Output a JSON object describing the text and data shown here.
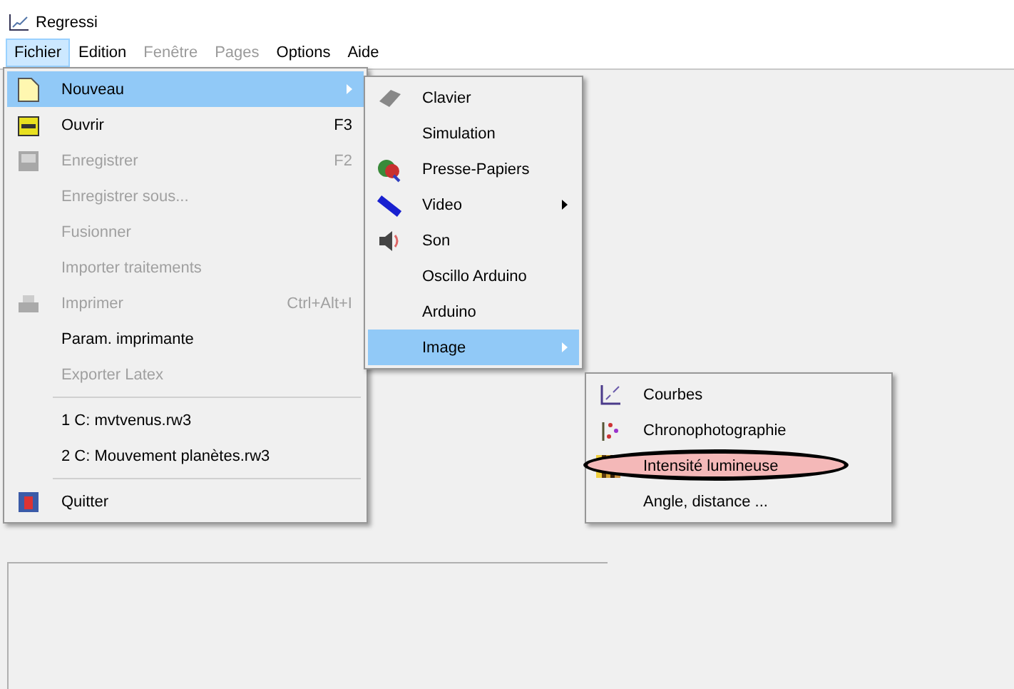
{
  "window": {
    "title": "Regressi"
  },
  "menu_bar": [
    {
      "label": "Fichier",
      "selected": true,
      "disabled": false
    },
    {
      "label": "Edition",
      "selected": false,
      "disabled": false
    },
    {
      "label": "Fenêtre",
      "selected": false,
      "disabled": true
    },
    {
      "label": "Pages",
      "selected": false,
      "disabled": true
    },
    {
      "label": "Options",
      "selected": false,
      "disabled": false
    },
    {
      "label": "Aide",
      "selected": false,
      "disabled": false
    }
  ],
  "file_menu": [
    {
      "kind": "item",
      "label": "Nouveau",
      "selected": true,
      "disabled": false,
      "submenu": true
    },
    {
      "kind": "item",
      "label": "Ouvrir",
      "shortcut": "F3",
      "selected": false,
      "disabled": false,
      "submenu": false
    },
    {
      "kind": "item",
      "label": "Enregistrer",
      "shortcut": "F2",
      "selected": false,
      "disabled": true,
      "submenu": false
    },
    {
      "kind": "item",
      "label": "Enregistrer sous...",
      "selected": false,
      "disabled": true,
      "submenu": false
    },
    {
      "kind": "item",
      "label": "Fusionner",
      "selected": false,
      "disabled": true,
      "submenu": false
    },
    {
      "kind": "item",
      "label": "Importer traitements",
      "selected": false,
      "disabled": true,
      "submenu": false
    },
    {
      "kind": "item",
      "label": "Imprimer",
      "shortcut": "Ctrl+Alt+I",
      "selected": false,
      "disabled": true,
      "submenu": false
    },
    {
      "kind": "item",
      "label": "Param. imprimante",
      "selected": false,
      "disabled": false,
      "submenu": false
    },
    {
      "kind": "item",
      "label": "Exporter Latex",
      "selected": false,
      "disabled": true,
      "submenu": false
    },
    {
      "kind": "separator"
    },
    {
      "kind": "item",
      "label": "1 C: mvtvenus.rw3",
      "selected": false,
      "disabled": false,
      "submenu": false
    },
    {
      "kind": "item",
      "label": "2 C: Mouvement planètes.rw3",
      "selected": false,
      "disabled": false,
      "submenu": false
    },
    {
      "kind": "separator"
    },
    {
      "kind": "item",
      "label": "Quitter",
      "selected": false,
      "disabled": false,
      "submenu": false
    }
  ],
  "new_submenu": [
    {
      "kind": "item",
      "label": "Clavier",
      "selected": false,
      "disabled": false,
      "submenu": false
    },
    {
      "kind": "item",
      "label": "Simulation",
      "selected": false,
      "disabled": false,
      "submenu": false
    },
    {
      "kind": "item",
      "label": "Presse-Papiers",
      "selected": false,
      "disabled": false,
      "submenu": false
    },
    {
      "kind": "item",
      "label": "Video",
      "selected": false,
      "disabled": false,
      "submenu": true
    },
    {
      "kind": "item",
      "label": "Son",
      "selected": false,
      "disabled": false,
      "submenu": false
    },
    {
      "kind": "item",
      "label": "Oscillo Arduino",
      "selected": false,
      "disabled": false,
      "submenu": false
    },
    {
      "kind": "item",
      "label": "Arduino",
      "selected": false,
      "disabled": false,
      "submenu": false
    },
    {
      "kind": "item",
      "label": "Image",
      "selected": true,
      "disabled": false,
      "submenu": true
    }
  ],
  "image_submenu": [
    {
      "kind": "item",
      "label": "Courbes",
      "selected": false,
      "disabled": false,
      "submenu": false,
      "circled": false
    },
    {
      "kind": "item",
      "label": "Chronophotographie",
      "selected": false,
      "disabled": false,
      "submenu": false,
      "circled": false
    },
    {
      "kind": "item",
      "label": "Intensité lumineuse",
      "selected": false,
      "disabled": false,
      "submenu": false,
      "circled": true
    },
    {
      "kind": "item",
      "label": "Angle, distance ...",
      "selected": false,
      "disabled": false,
      "submenu": false,
      "circled": false
    }
  ]
}
